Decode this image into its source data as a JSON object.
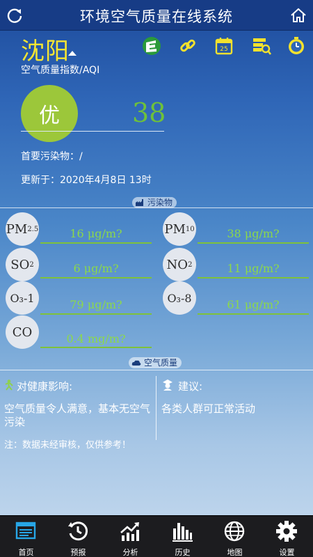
{
  "header": {
    "title": "环境空气质量在线系统"
  },
  "city": {
    "name": "沈阳"
  },
  "aqi": {
    "label": "空气质量指数/AQI",
    "level": "优",
    "value": "38",
    "level_color": "#9cc73a"
  },
  "info": {
    "primary_pollutant": "首要污染物：/",
    "updated": "更新于：2020年4月8日 13时"
  },
  "sections": {
    "pollutants_badge": "污染物",
    "air_quality_badge": "空气质量"
  },
  "pollutants": [
    {
      "name": "PM",
      "sub": "2.5",
      "value": "16   μg/m?"
    },
    {
      "name": "PM",
      "sub": "10",
      "value": "38   μg/m?"
    },
    {
      "name": "SO",
      "sub": "2",
      "value": "6   μg/m?"
    },
    {
      "name": "NO",
      "sub": "2",
      "value": "11   μg/m?"
    },
    {
      "name": "O₃-1",
      "sub": "",
      "value": "79   μg/m?"
    },
    {
      "name": "O₃-8",
      "sub": "",
      "value": "61   μg/m?"
    },
    {
      "name": "CO",
      "sub": "",
      "value": "0.4   mg/m?"
    }
  ],
  "health": {
    "effect_title": "对健康影响:",
    "effect_text": "空气质量令人满意，基本无空气污染",
    "advice_title": "建议:",
    "advice_text": "各类人群可正常活动",
    "note": "注：数据未经审核，仅供参考！"
  },
  "nav": [
    {
      "label": "首页",
      "icon": "home-screen-icon"
    },
    {
      "label": "预报",
      "icon": "history-clock-icon"
    },
    {
      "label": "分析",
      "icon": "trend-chart-icon"
    },
    {
      "label": "历史",
      "icon": "bar-chart-icon"
    },
    {
      "label": "地图",
      "icon": "globe-icon"
    },
    {
      "label": "设置",
      "icon": "gear-icon"
    }
  ],
  "colors": {
    "header_bg": "#173c86",
    "accent_green": "#7fc23a",
    "city_yellow": "#f7e631",
    "nav_bg": "#1c1c1f"
  }
}
